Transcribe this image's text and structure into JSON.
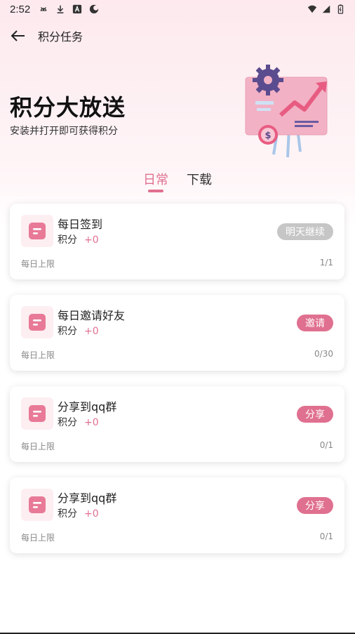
{
  "status_bar": {
    "time": "2:52",
    "left_icons": [
      "android-icon",
      "download-icon",
      "a-icon",
      "moon-icon"
    ],
    "right_icons": [
      "wifi-icon",
      "signal-icon",
      "battery-icon"
    ]
  },
  "nav": {
    "title": "积分任务",
    "back_icon": "arrow-left-icon"
  },
  "hero": {
    "title": "积分大放送",
    "subtitle": "安装并打开即可获得积分"
  },
  "tabs": [
    {
      "label": "日常",
      "active": true
    },
    {
      "label": "下载",
      "active": false
    }
  ],
  "tasks": [
    {
      "name": "每日签到",
      "points_label": "积分",
      "points_value": "+0",
      "action": "明天继续",
      "action_enabled": false,
      "limit_label": "每日上限",
      "limit_value": "1/1"
    },
    {
      "name": "每日邀请好友",
      "points_label": "积分",
      "points_value": "+0",
      "action": "邀请",
      "action_enabled": true,
      "limit_label": "每日上限",
      "limit_value": "0/30"
    },
    {
      "name": "分享到qq群",
      "points_label": "积分",
      "points_value": "+0",
      "action": "分享",
      "action_enabled": true,
      "limit_label": "每日上限",
      "limit_value": "0/1"
    },
    {
      "name": "分享到qq群",
      "points_label": "积分",
      "points_value": "+0",
      "action": "分享",
      "action_enabled": true,
      "limit_label": "每日上限",
      "limit_value": "0/1"
    }
  ],
  "colors": {
    "accent": "#e0708f",
    "disabled": "#c6c6c6",
    "icon_bg": "#fdeef1"
  }
}
